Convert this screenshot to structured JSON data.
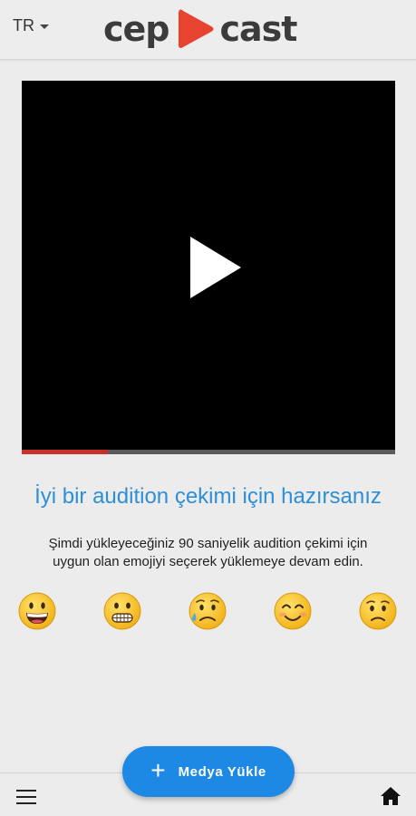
{
  "header": {
    "language": "TR",
    "logo_left": "cep",
    "logo_right": "cast",
    "logo_mark_color": "#e8432e"
  },
  "video": {
    "progress": 0.23,
    "progress_color": "#c8302a"
  },
  "main": {
    "title": "İyi bir audition çekimi için hazırsanız",
    "description": "Şimdi yükleyeceğiniz 90 saniyelik audition çekimi için uygun olan emojiyi seçerek yüklemeye devam edin.",
    "emojis": [
      "grinning-face",
      "grimacing-face",
      "sad-but-relieved-face",
      "smiling-face",
      "worried-face"
    ]
  },
  "fab": {
    "label": "Medya Yükle",
    "color": "#1e88e5"
  },
  "bottom_bar": {
    "left_icon": "menu-icon",
    "right_icon": "home-icon"
  }
}
